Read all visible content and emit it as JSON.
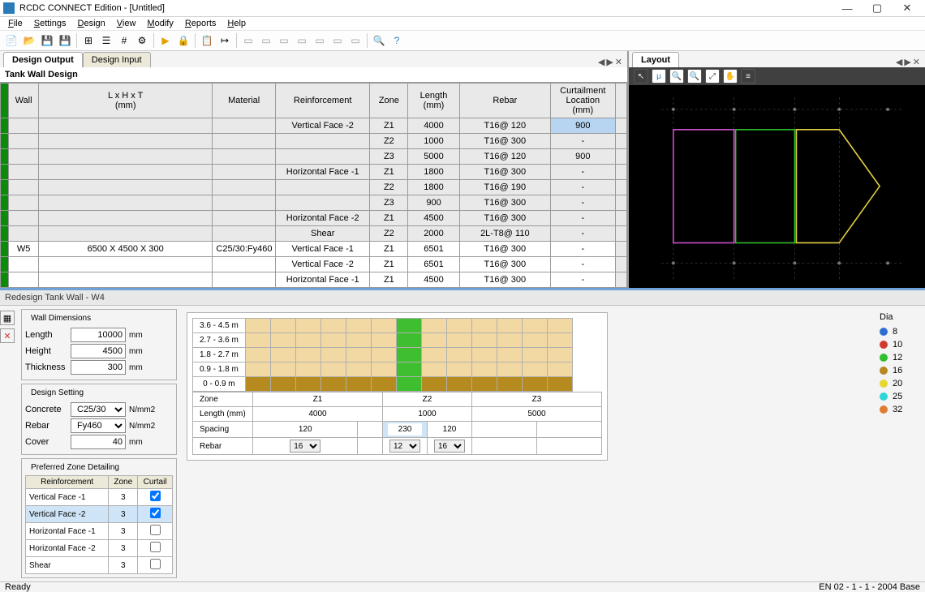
{
  "window": {
    "title": "RCDC CONNECT Edition - [Untitled]"
  },
  "menu": [
    "File",
    "Settings",
    "Design",
    "View",
    "Modify",
    "Reports",
    "Help"
  ],
  "tabs": {
    "left": [
      "Design Output",
      "Design Input"
    ],
    "active": 0,
    "right": "Layout"
  },
  "section_label": "Tank Wall Design",
  "grid": {
    "headers": [
      "Wall",
      "L x H x T\n(mm)",
      "Material",
      "Reinforcement",
      "Zone",
      "Length\n(mm)",
      "Rebar",
      "Curtailment\nLocation\n(mm)"
    ],
    "rows": [
      {
        "alt": true,
        "wall": "",
        "lxhxt": "",
        "mat": "",
        "reinf": "Vertical Face -2",
        "zone": "Z1",
        "len": "4000",
        "rebar": "T16@ 120",
        "curt": "900",
        "curt_sel": true
      },
      {
        "alt": true,
        "wall": "",
        "lxhxt": "",
        "mat": "",
        "reinf": "",
        "zone": "Z2",
        "len": "1000",
        "rebar": "T16@ 300",
        "curt": "-"
      },
      {
        "alt": true,
        "wall": "",
        "lxhxt": "",
        "mat": "",
        "reinf": "",
        "zone": "Z3",
        "len": "5000",
        "rebar": "T16@ 120",
        "curt": "900"
      },
      {
        "alt": true,
        "wall": "",
        "lxhxt": "",
        "mat": "",
        "reinf": "Horizontal Face -1",
        "zone": "Z1",
        "len": "1800",
        "rebar": "T16@ 300",
        "curt": "-"
      },
      {
        "alt": true,
        "wall": "",
        "lxhxt": "",
        "mat": "",
        "reinf": "",
        "zone": "Z2",
        "len": "1800",
        "rebar": "T16@ 190",
        "curt": "-"
      },
      {
        "alt": true,
        "wall": "",
        "lxhxt": "",
        "mat": "",
        "reinf": "",
        "zone": "Z3",
        "len": "900",
        "rebar": "T16@ 300",
        "curt": "-"
      },
      {
        "alt": true,
        "wall": "",
        "lxhxt": "",
        "mat": "",
        "reinf": "Horizontal Face -2",
        "zone": "Z1",
        "len": "4500",
        "rebar": "T16@ 300",
        "curt": "-"
      },
      {
        "alt": true,
        "wall": "",
        "lxhxt": "",
        "mat": "",
        "reinf": "Shear",
        "zone": "Z2",
        "len": "2000",
        "rebar": "2L-T8@ 110",
        "curt": "-"
      },
      {
        "alt": false,
        "wall": "W5",
        "lxhxt": "6500 X 4500 X 300",
        "mat": "C25/30:Fy460",
        "reinf": "Vertical Face -1",
        "zone": "Z1",
        "len": "6501",
        "rebar": "T16@ 300",
        "curt": "-"
      },
      {
        "alt": false,
        "wall": "",
        "lxhxt": "",
        "mat": "",
        "reinf": "Vertical Face -2",
        "zone": "Z1",
        "len": "6501",
        "rebar": "T16@ 300",
        "curt": "-"
      },
      {
        "alt": false,
        "wall": "",
        "lxhxt": "",
        "mat": "",
        "reinf": "Horizontal Face -1",
        "zone": "Z1",
        "len": "4500",
        "rebar": "T16@ 300",
        "curt": "-"
      }
    ]
  },
  "redesign": {
    "title": "Redesign Tank Wall - W4",
    "dims": {
      "title": "Wall Dimensions",
      "length_label": "Length",
      "length": "10000",
      "height_label": "Height",
      "height": "4500",
      "thick_label": "Thickness",
      "thick": "300",
      "unit": "mm"
    },
    "design": {
      "title": "Design Setting",
      "concrete_label": "Concrete",
      "concrete": "C25/30",
      "rebar_label": "Rebar",
      "rebar": "Fy460",
      "cover_label": "Cover",
      "cover": "40",
      "unit1": "N/mm2",
      "unit2": "mm"
    },
    "zone": {
      "title": "Preferred Zone Detailing",
      "headers": [
        "Reinforcement",
        "Zone",
        "Curtail"
      ],
      "rows": [
        {
          "r": "Vertical Face -1",
          "z": "3",
          "c": true
        },
        {
          "r": "Vertical Face -2",
          "z": "3",
          "c": true,
          "sel": true
        },
        {
          "r": "Horizontal Face -1",
          "z": "3",
          "c": false
        },
        {
          "r": "Horizontal Face -2",
          "z": "3",
          "c": false
        },
        {
          "r": "Shear",
          "z": "3",
          "c": false
        }
      ]
    },
    "heights": [
      "3.6 - 4.5 m",
      "2.7 - 3.6 m",
      "1.8 - 2.7 m",
      "0.9 - 1.8 m",
      "0 - 0.9 m"
    ],
    "zonegrid": {
      "zone_label": "Zone",
      "zones": [
        "Z1",
        "Z2",
        "Z3"
      ],
      "len_label": "Length (mm)",
      "lens": [
        "4000",
        "1000",
        "5000"
      ],
      "spacing_label": "Spacing",
      "spacing": [
        "120",
        "",
        "230",
        "120",
        ""
      ],
      "rebar_label": "Rebar",
      "rebar": [
        "16",
        "",
        "12",
        "16",
        ""
      ]
    },
    "legend": {
      "title": "Dia",
      "items": [
        {
          "d": "8",
          "c": "#2f6fd1"
        },
        {
          "d": "10",
          "c": "#d13a2f"
        },
        {
          "d": "12",
          "c": "#2fbf2f"
        },
        {
          "d": "16",
          "c": "#b58a1e"
        },
        {
          "d": "20",
          "c": "#e6d62f"
        },
        {
          "d": "25",
          "c": "#2fd6d6"
        },
        {
          "d": "32",
          "c": "#e07b2f"
        }
      ]
    }
  },
  "status": {
    "left": "Ready",
    "right": "EN 02 - 1 - 1 - 2004 Base"
  }
}
